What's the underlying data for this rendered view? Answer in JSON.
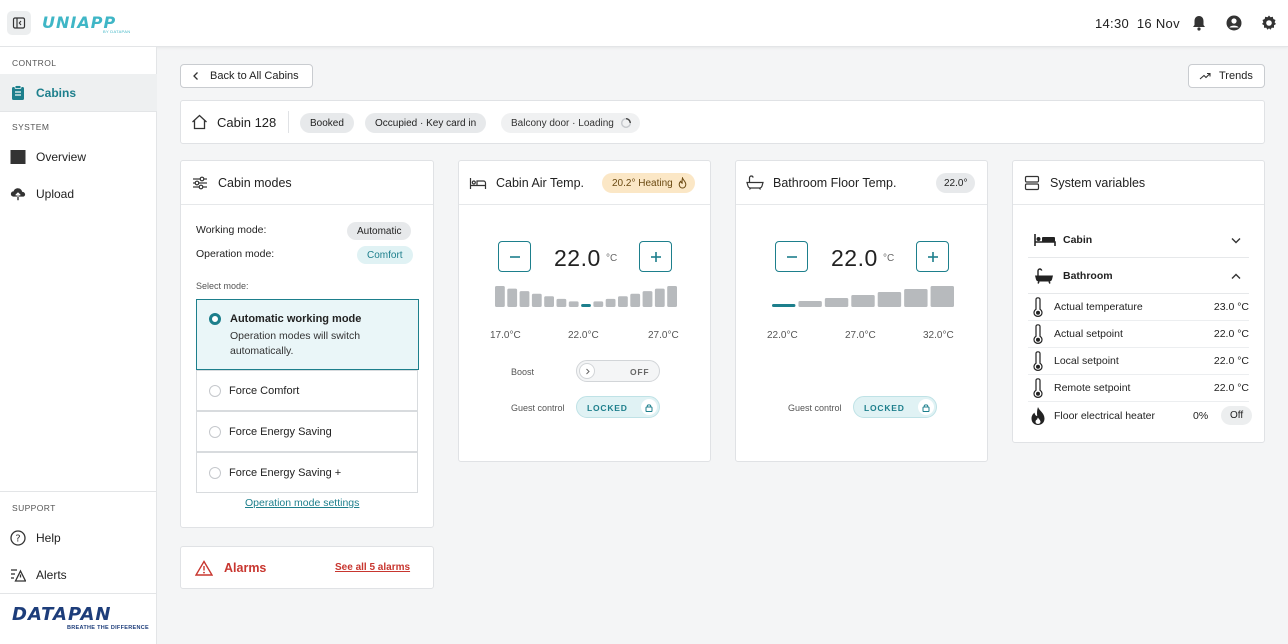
{
  "app": {
    "logo": "UNIAPP",
    "logo_sub": "BY DATAPAN"
  },
  "header": {
    "time": "14:30",
    "date": "16 Nov"
  },
  "sidebar": {
    "sections": {
      "control": "CONTROL",
      "system": "SYSTEM",
      "support": "SUPPORT"
    },
    "items": {
      "cabins": "Cabins",
      "overview": "Overview",
      "upload": "Upload",
      "help": "Help",
      "alerts": "Alerts"
    },
    "brand": "DATAPAN",
    "brand_sub": "BREATHE THE DIFFERENCE"
  },
  "toolbar": {
    "back_label": "Back to All Cabins",
    "trends_label": "Trends"
  },
  "cabin": {
    "name": "Cabin 128",
    "badges": [
      "Booked",
      "Occupied · Key card in",
      "Balcony door · Loading"
    ]
  },
  "cabin_modes": {
    "title": "Cabin modes",
    "working_mode_label": "Working mode:",
    "working_mode_value": "Automatic",
    "operation_mode_label": "Operation mode:",
    "operation_mode_value": "Comfort",
    "select_label": "Select mode:",
    "selected": {
      "title": "Automatic working mode",
      "desc_line1": "Operation modes will switch",
      "desc_line2": "automatically."
    },
    "options": [
      "Force Comfort",
      "Force Energy Saving",
      "Force Energy Saving +"
    ],
    "settings_link": "Operation mode settings"
  },
  "alarms": {
    "title": "Alarms",
    "link": "See all 5 alarms"
  },
  "air_temp": {
    "title": "Cabin Air Temp.",
    "badge": "20.2° Heating",
    "value": "22.0",
    "unit": "°C",
    "scale": {
      "min": "17.0°C",
      "mid": "22.0°C",
      "max": "27.0°C",
      "current_fraction": 0.5
    },
    "boost_label": "Boost",
    "boost_state": "OFF",
    "guest_label": "Guest control",
    "guest_state": "LOCKED"
  },
  "floor_temp": {
    "title": "Bathroom Floor Temp.",
    "badge": "22.0°",
    "value": "22.0",
    "unit": "°C",
    "scale": {
      "min": "22.0°C",
      "mid": "27.0°C",
      "max": "32.0°C",
      "current_fraction": 0.0
    },
    "guest_label": "Guest control",
    "guest_state": "LOCKED"
  },
  "system_vars": {
    "title": "System variables",
    "groups": {
      "cabin": "Cabin",
      "bathroom": "Bathroom"
    },
    "rows": [
      {
        "label": "Actual temperature",
        "value": "23.0 °C",
        "icon": "thermometer-icon"
      },
      {
        "label": "Actual setpoint",
        "value": "22.0 °C",
        "icon": "thermometer-icon"
      },
      {
        "label": "Local setpoint",
        "value": "22.0 °C",
        "icon": "thermometer-icon"
      },
      {
        "label": "Remote setpoint",
        "value": "22.0 °C",
        "icon": "thermometer-icon"
      }
    ],
    "heater": {
      "label": "Floor electrical heater",
      "percent": "0%",
      "state": "Off"
    }
  },
  "colors": {
    "accent": "#1d7f8c",
    "danger": "#c8362f",
    "brand": "#1d3d7a"
  }
}
